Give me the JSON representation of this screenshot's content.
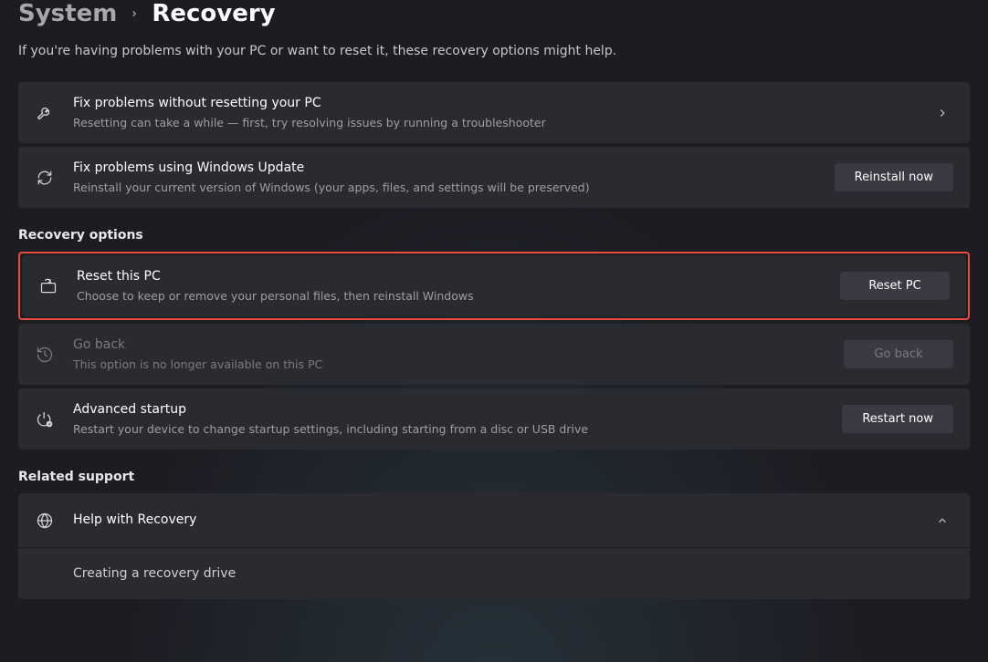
{
  "breadcrumb": {
    "parent": "System",
    "current": "Recovery"
  },
  "page_description": "If you're having problems with your PC or want to reset it, these recovery options might help.",
  "cards": {
    "fix_problems": {
      "title": "Fix problems without resetting your PC",
      "sub": "Resetting can take a while — first, try resolving issues by running a troubleshooter"
    },
    "windows_update": {
      "title": "Fix problems using Windows Update",
      "sub": "Reinstall your current version of Windows (your apps, files, and settings will be preserved)",
      "button": "Reinstall now"
    }
  },
  "sections": {
    "recovery_options": "Recovery options",
    "related_support": "Related support"
  },
  "recovery": {
    "reset_pc": {
      "title": "Reset this PC",
      "sub": "Choose to keep or remove your personal files, then reinstall Windows",
      "button": "Reset PC"
    },
    "go_back": {
      "title": "Go back",
      "sub": "This option is no longer available on this PC",
      "button": "Go back"
    },
    "advanced": {
      "title": "Advanced startup",
      "sub": "Restart your device to change startup settings, including starting from a disc or USB drive",
      "button": "Restart now"
    }
  },
  "support": {
    "help": "Help with Recovery",
    "sub_item": "Creating a recovery drive"
  }
}
